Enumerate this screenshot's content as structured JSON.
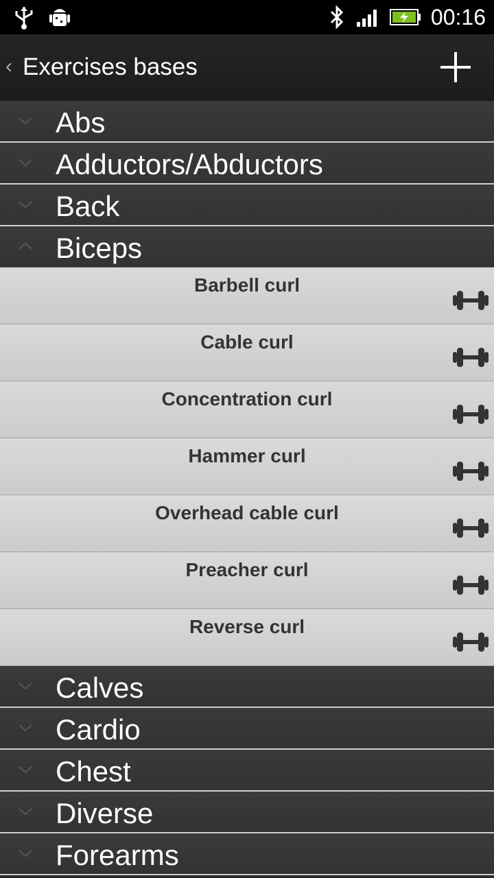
{
  "status": {
    "time": "00:16"
  },
  "header": {
    "title": "Exercises bases",
    "add_icon": "plus-icon"
  },
  "groups": [
    {
      "label": "Abs",
      "expanded": false
    },
    {
      "label": "Adductors/Abductors",
      "expanded": false
    },
    {
      "label": "Back",
      "expanded": false
    },
    {
      "label": "Biceps",
      "expanded": true
    },
    {
      "label": "Calves",
      "expanded": false
    },
    {
      "label": "Cardio",
      "expanded": false
    },
    {
      "label": "Chest",
      "expanded": false
    },
    {
      "label": "Diverse",
      "expanded": false
    },
    {
      "label": "Forearms",
      "expanded": false
    }
  ],
  "biceps_exercises": [
    {
      "label": "Barbell curl"
    },
    {
      "label": "Cable curl"
    },
    {
      "label": "Concentration curl"
    },
    {
      "label": "Hammer curl"
    },
    {
      "label": "Overhead cable curl"
    },
    {
      "label": "Preacher curl"
    },
    {
      "label": "Reverse curl"
    }
  ],
  "colors": {
    "accent_battery": "#7ec020"
  }
}
